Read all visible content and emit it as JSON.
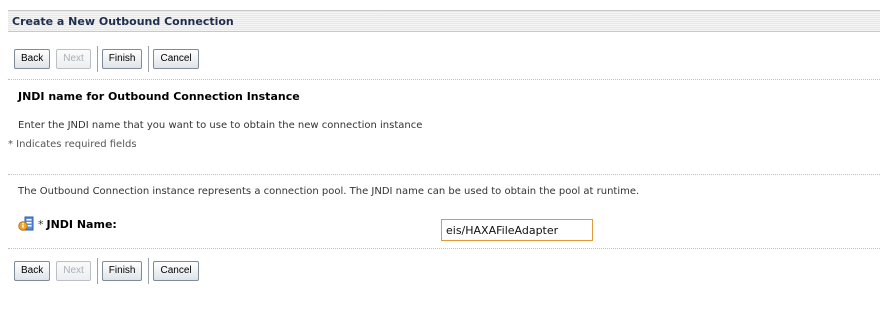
{
  "header": {
    "title": "Create a New Outbound Connection"
  },
  "top_buttons": {
    "back": "Back",
    "next": "Next",
    "finish": "Finish",
    "cancel": "Cancel"
  },
  "section": {
    "heading": "JNDI name for Outbound Connection Instance",
    "instruction": "Enter the JNDI name that you want to use to obtain the new connection instance",
    "required_note": "* Indicates required fields",
    "info": "The Outbound Connection instance represents a connection pool. The JNDI name can be used to obtain the pool at runtime."
  },
  "field": {
    "required_marker": "*",
    "label": "JNDI Name:",
    "value": "eis/HAXAFileAdapter",
    "icon": "help-field-icon"
  },
  "bottom_buttons": {
    "back": "Back",
    "next": "Next",
    "finish": "Finish",
    "cancel": "Cancel"
  },
  "colors": {
    "title_text": "#1f2e4d",
    "input_border": "#e09a3a",
    "titlebar_bg": "#e8e8e8"
  }
}
